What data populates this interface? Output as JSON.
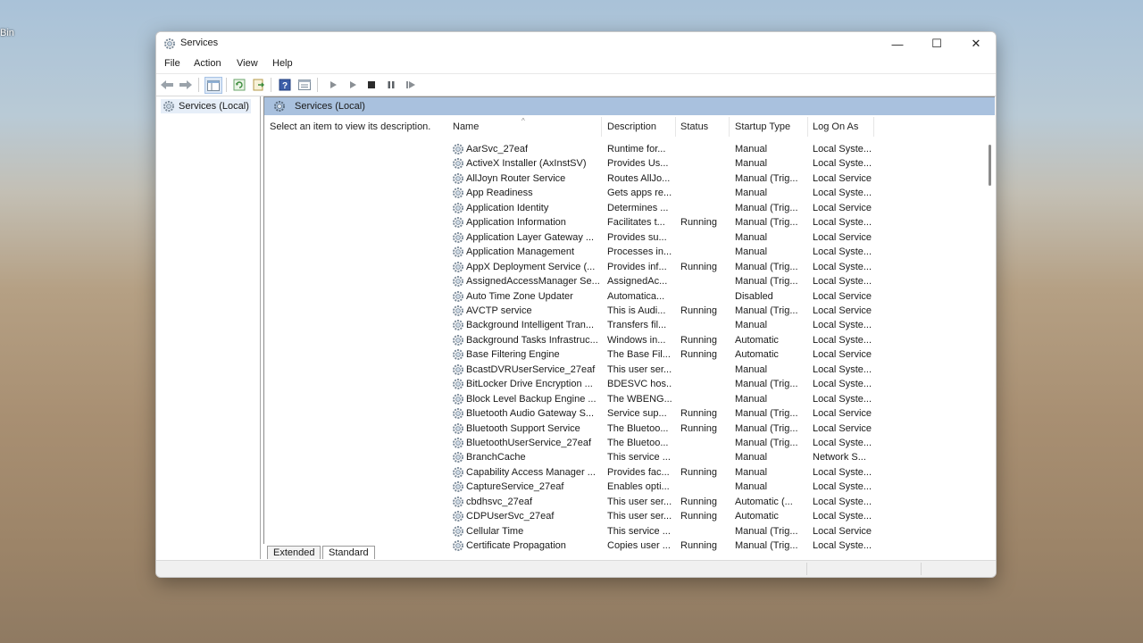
{
  "desktop": {
    "label": "Bin"
  },
  "window": {
    "title": "Services",
    "controls": {
      "minimize": "—",
      "maximize": "☐",
      "close": "✕"
    }
  },
  "menu": [
    "File",
    "Action",
    "View",
    "Help"
  ],
  "toolbar_icons": [
    "back-arrow-icon",
    "forward-arrow-icon",
    "show-hide-console-tree-icon",
    "refresh-icon",
    "export-list-icon",
    "help-icon",
    "properties-icon",
    "start-service-icon",
    "start-service-alt-icon",
    "stop-service-icon",
    "pause-service-icon",
    "restart-service-icon"
  ],
  "tree": {
    "root": "Services (Local)"
  },
  "main": {
    "header": "Services (Local)",
    "description_prompt": "Select an item to view its description."
  },
  "columns": [
    "Name",
    "Description",
    "Status",
    "Startup Type",
    "Log On As"
  ],
  "services": [
    [
      "AarSvc_27eaf",
      "Runtime for...",
      "",
      "Manual",
      "Local Syste..."
    ],
    [
      "ActiveX Installer (AxInstSV)",
      "Provides Us...",
      "",
      "Manual",
      "Local Syste..."
    ],
    [
      "AllJoyn Router Service",
      "Routes AllJo...",
      "",
      "Manual (Trig...",
      "Local Service"
    ],
    [
      "App Readiness",
      "Gets apps re...",
      "",
      "Manual",
      "Local Syste..."
    ],
    [
      "Application Identity",
      "Determines ...",
      "",
      "Manual (Trig...",
      "Local Service"
    ],
    [
      "Application Information",
      "Facilitates t...",
      "Running",
      "Manual (Trig...",
      "Local Syste..."
    ],
    [
      "Application Layer Gateway ...",
      "Provides su...",
      "",
      "Manual",
      "Local Service"
    ],
    [
      "Application Management",
      "Processes in...",
      "",
      "Manual",
      "Local Syste..."
    ],
    [
      "AppX Deployment Service (...",
      "Provides inf...",
      "Running",
      "Manual (Trig...",
      "Local Syste..."
    ],
    [
      "AssignedAccessManager Se...",
      "AssignedAc...",
      "",
      "Manual (Trig...",
      "Local Syste..."
    ],
    [
      "Auto Time Zone Updater",
      "Automatica...",
      "",
      "Disabled",
      "Local Service"
    ],
    [
      "AVCTP service",
      "This is Audi...",
      "Running",
      "Manual (Trig...",
      "Local Service"
    ],
    [
      "Background Intelligent Tran...",
      "Transfers fil...",
      "",
      "Manual",
      "Local Syste..."
    ],
    [
      "Background Tasks Infrastruc...",
      "Windows in...",
      "Running",
      "Automatic",
      "Local Syste..."
    ],
    [
      "Base Filtering Engine",
      "The Base Fil...",
      "Running",
      "Automatic",
      "Local Service"
    ],
    [
      "BcastDVRUserService_27eaf",
      "This user ser...",
      "",
      "Manual",
      "Local Syste..."
    ],
    [
      "BitLocker Drive Encryption ...",
      "BDESVC hos...",
      "",
      "Manual (Trig...",
      "Local Syste..."
    ],
    [
      "Block Level Backup Engine ...",
      "The WBENG...",
      "",
      "Manual",
      "Local Syste..."
    ],
    [
      "Bluetooth Audio Gateway S...",
      "Service sup...",
      "Running",
      "Manual (Trig...",
      "Local Service"
    ],
    [
      "Bluetooth Support Service",
      "The Bluetoo...",
      "Running",
      "Manual (Trig...",
      "Local Service"
    ],
    [
      "BluetoothUserService_27eaf",
      "The Bluetoo...",
      "",
      "Manual (Trig...",
      "Local Syste..."
    ],
    [
      "BranchCache",
      "This service ...",
      "",
      "Manual",
      "Network S..."
    ],
    [
      "Capability Access Manager ...",
      "Provides fac...",
      "Running",
      "Manual",
      "Local Syste..."
    ],
    [
      "CaptureService_27eaf",
      "Enables opti...",
      "",
      "Manual",
      "Local Syste..."
    ],
    [
      "cbdhsvc_27eaf",
      "This user ser...",
      "Running",
      "Automatic (...",
      "Local Syste..."
    ],
    [
      "CDPUserSvc_27eaf",
      "This user ser...",
      "Running",
      "Automatic",
      "Local Syste..."
    ],
    [
      "Cellular Time",
      "This service ...",
      "",
      "Manual (Trig...",
      "Local Service"
    ],
    [
      "Certificate Propagation",
      "Copies user ...",
      "Running",
      "Manual (Trig...",
      "Local Syste..."
    ]
  ],
  "tabs": [
    "Extended",
    "Standard"
  ]
}
